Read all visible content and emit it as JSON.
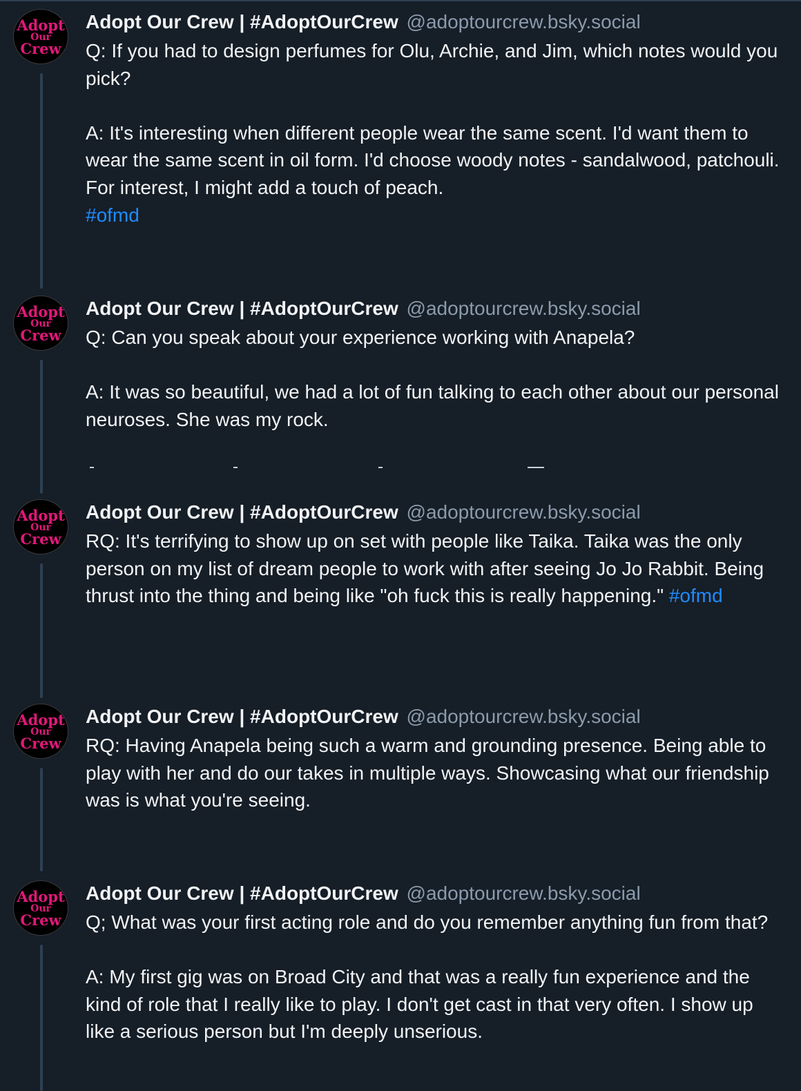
{
  "thread": {
    "posts": [
      {
        "author": {
          "display_name": "Adopt Our Crew | #AdoptOurCrew",
          "handle": "@adoptourcrew.bsky.social",
          "avatar_text": [
            "Adopt",
            "Our",
            "Crew"
          ]
        },
        "paragraphs": [
          {
            "text": "Q: If you had to design perfumes for Olu, Archie, and Jim, which notes would you pick?",
            "hashtag": ""
          },
          {
            "text": "A: It's interesting when different people wear the same scent. I'd want them to wear the same scent in oil form. I'd choose woody notes - sandalwood, patchouli. For interest, I might add a touch of peach.",
            "hashtag": ""
          },
          {
            "text": "",
            "hashtag": "#ofmd"
          }
        ]
      },
      {
        "author": {
          "display_name": "Adopt Our Crew | #AdoptOurCrew",
          "handle": "@adoptourcrew.bsky.social",
          "avatar_text": [
            "Adopt",
            "Our",
            "Crew"
          ]
        },
        "paragraphs": [
          {
            "text": "Q: Can you speak about your experience working with Anapela?",
            "hashtag": ""
          },
          {
            "text": "A: It was so beautiful, we had a lot of fun talking to each other about our personal neuroses. She was my rock.",
            "hashtag": ""
          }
        ]
      },
      {
        "author": {
          "display_name": "Adopt Our Crew | #AdoptOurCrew",
          "handle": "@adoptourcrew.bsky.social",
          "avatar_text": [
            "Adopt",
            "Our",
            "Crew"
          ]
        },
        "paragraphs": [
          {
            "text": "RQ: It's terrifying to show up on set with people like Taika. Taika was the only person on my list of dream people to work with after seeing Jo Jo Rabbit. Being thrust into the thing and being like \"oh fuck this is really happening.\" ",
            "hashtag": "#ofmd"
          }
        ]
      },
      {
        "author": {
          "display_name": "Adopt Our Crew | #AdoptOurCrew",
          "handle": "@adoptourcrew.bsky.social",
          "avatar_text": [
            "Adopt",
            "Our",
            "Crew"
          ]
        },
        "paragraphs": [
          {
            "text": "RQ: Having Anapela being such a warm and grounding presence. Being able to play with her and do our takes in multiple ways. Showcasing what our friendship was is what you're seeing.",
            "hashtag": ""
          }
        ]
      },
      {
        "author": {
          "display_name": "Adopt Our Crew | #AdoptOurCrew",
          "handle": "@adoptourcrew.bsky.social",
          "avatar_text": [
            "Adopt",
            "Our",
            "Crew"
          ]
        },
        "paragraphs": [
          {
            "text": "Q; What was your first acting role and do you remember anything fun from that?",
            "hashtag": ""
          },
          {
            "text": "A: My first gig was on Broad City and that was a really fun experience and the kind of role that I really like to play. I don't get cast in that very often. I show up like a serious person but I'm deeply unserious.",
            "hashtag": ""
          }
        ]
      }
    ]
  },
  "colors": {
    "background": "#161e27",
    "text": "#f1f3f5",
    "handle": "#8b9bad",
    "hashtag": "#208bfe",
    "thread_line": "#2e4052",
    "avatar_logo": "#e0187a"
  },
  "icons": {
    "avatar": "adopt-our-crew-logo"
  }
}
